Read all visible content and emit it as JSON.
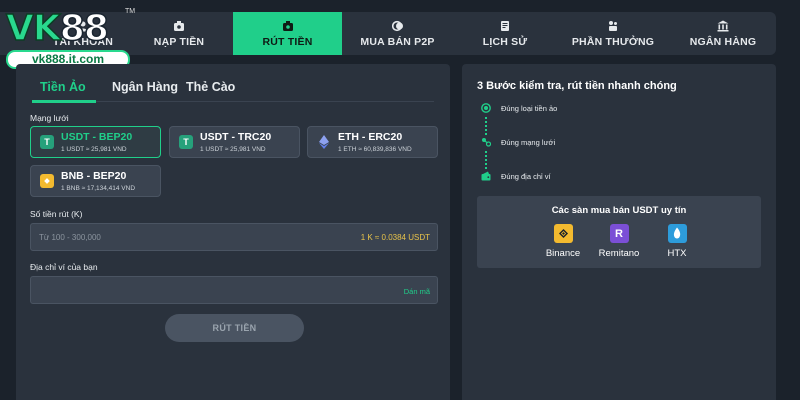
{
  "brand": {
    "logo_vk": "VK",
    "logo_88": "88",
    "trademark": "TM",
    "url": "vk888.it.com"
  },
  "nav": {
    "items": [
      {
        "label": "TÀI KHOẢN",
        "icon": "user-icon"
      },
      {
        "label": "NẠP TIỀN",
        "icon": "deposit-icon"
      },
      {
        "label": "RÚT TIỀN",
        "icon": "withdraw-icon",
        "active": true
      },
      {
        "label": "MUA BÁN P2P",
        "icon": "coins-icon"
      },
      {
        "label": "LỊCH SỬ",
        "icon": "history-icon"
      },
      {
        "label": "PHẦN THƯỞNG",
        "icon": "reward-icon"
      },
      {
        "label": "NGÂN HÀNG",
        "icon": "bank-icon"
      }
    ]
  },
  "tabs": [
    {
      "label": "Tiền Ảo",
      "active": true
    },
    {
      "label": "Ngân Hàng"
    },
    {
      "label": "Thẻ Cào"
    }
  ],
  "network": {
    "label": "Mạng lưới",
    "options": [
      {
        "name": "USDT - BEP20",
        "rate": "1 USDT ≈ 25,981 VND",
        "icon": "tether-icon",
        "color": "#26a17b",
        "selected": true
      },
      {
        "name": "USDT - TRC20",
        "rate": "1 USDT ≈ 25,981 VND",
        "icon": "tether-icon",
        "color": "#26a17b"
      },
      {
        "name": "ETH - ERC20",
        "rate": "1 ETH ≈ 60,839,836 VND",
        "icon": "ethereum-icon",
        "color": "#627eea"
      },
      {
        "name": "BNB - BEP20",
        "rate": "1 BNB ≈ 17,134,414 VND",
        "icon": "bnb-icon",
        "color": "#f3ba2f"
      }
    ]
  },
  "amount": {
    "label": "Số tiền rút (K)",
    "placeholder": "Từ 100 - 300,000",
    "rate_hint": "1 K ≈ 0.0384 USDT"
  },
  "wallet": {
    "label": "Địa chỉ ví của bạn",
    "paste_label": "Dán mã"
  },
  "submit_label": "RÚT TIỀN",
  "steps": {
    "title": "3 Bước kiểm tra, rút tiền nhanh chóng",
    "items": [
      {
        "text": "Đúng loại tiền ảo",
        "icon": "coin-check-icon"
      },
      {
        "text": "Đúng mạng lưới",
        "icon": "network-icon"
      },
      {
        "text": "Đúng địa chỉ ví",
        "icon": "wallet-icon"
      }
    ]
  },
  "exchanges": {
    "title": "Các sàn mua bán USDT uy tín",
    "items": [
      {
        "name": "Binance",
        "icon": "binance-icon",
        "color": "#f3ba2f"
      },
      {
        "name": "Remitano",
        "icon": "remitano-icon",
        "color": "#7b4fd6"
      },
      {
        "name": "HTX",
        "icon": "htx-icon",
        "color": "#2d9cdb"
      }
    ]
  },
  "colors": {
    "accent": "#20cf8a",
    "panel": "#2a323d",
    "background": "#1b222b",
    "field": "#3a4350",
    "hint_yellow": "#e8c34a"
  }
}
